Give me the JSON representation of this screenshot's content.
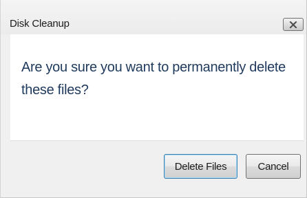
{
  "window": {
    "title": "Disk Cleanup",
    "close_icon": "close-icon"
  },
  "message": "Are you sure you want to permanently delete these files?",
  "buttons": {
    "delete_label": "Delete Files",
    "cancel_label": "Cancel"
  },
  "colors": {
    "message_text": "#1e395b",
    "default_button_border": "#3c7fb1"
  }
}
